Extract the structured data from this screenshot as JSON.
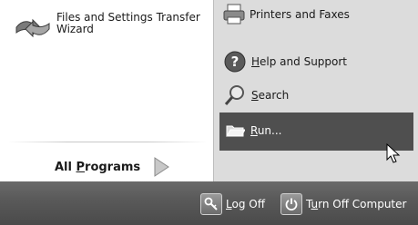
{
  "left_panel": {
    "files_transfer": {
      "line1": "Files and Settings Transfer",
      "line2": "Wizard"
    },
    "all_programs": {
      "prefix": "All ",
      "underlined": "P",
      "suffix": "rograms"
    }
  },
  "right_panel": {
    "printers_faxes": "Printers and Faxes",
    "help_support": {
      "underlined": "H",
      "rest": "elp and Support"
    },
    "search": {
      "underlined": "S",
      "rest": "earch"
    },
    "run": {
      "underlined": "R",
      "rest": "un..."
    }
  },
  "bottom_bar": {
    "log_off": {
      "underlined": "L",
      "rest": "og Off"
    },
    "turn_off": {
      "before": "T",
      "underlined": "u",
      "rest": "rn Off Computer"
    }
  },
  "colors": {
    "run_highlight": "#4f4f4f",
    "right_panel_bg": "#dcdcdc",
    "bottom_bar_bg": "#5a5a5a"
  }
}
